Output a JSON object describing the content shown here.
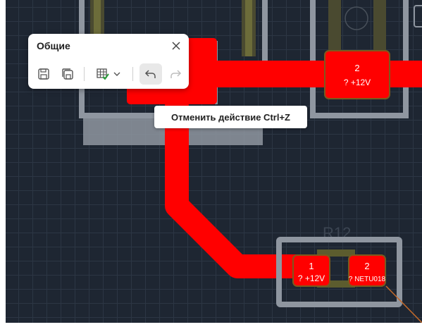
{
  "toolbar": {
    "title": "Общие",
    "buttons": [
      {
        "name": "save",
        "icon": "save-icon"
      },
      {
        "name": "save-all",
        "icon": "save-all-icon"
      },
      {
        "name": "drc",
        "icon": "grid-check-icon"
      },
      {
        "name": "undo",
        "icon": "undo-icon",
        "active": true
      },
      {
        "name": "redo",
        "icon": "redo-icon",
        "enabled": false
      }
    ],
    "close_icon": "close-icon"
  },
  "tooltip": {
    "text": "Отменить действие Ctrl+Z"
  },
  "board": {
    "colors": {
      "background": "#1e2632",
      "trace": "#ff0000",
      "outline": "#8f96a0",
      "pad_stroke": "#7c5a1e",
      "silk": "#5c5c2e"
    },
    "top_pad": {
      "number": "2",
      "net": "? +12V"
    },
    "component_r12": {
      "designator": "R12",
      "pad1": {
        "number": "1",
        "net": "? +12V"
      },
      "pad2": {
        "number": "2",
        "net": "? NETU018"
      }
    }
  }
}
